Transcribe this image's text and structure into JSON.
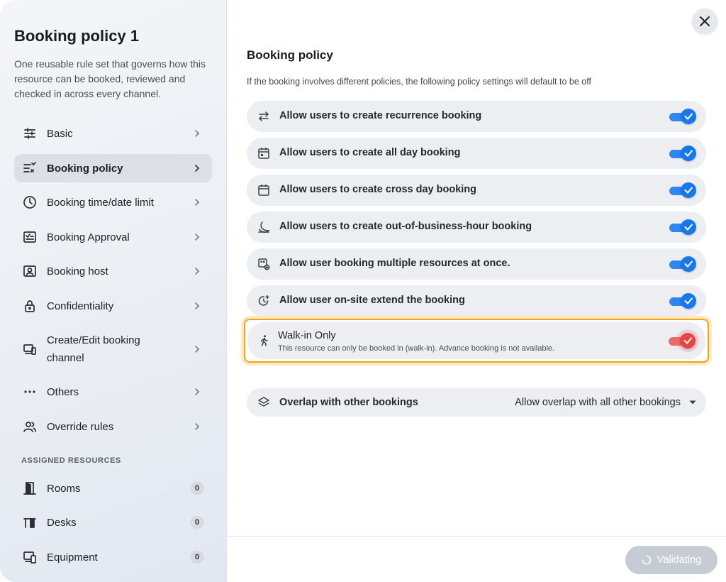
{
  "sidebar": {
    "title": "Booking policy 1",
    "description": "One reusable rule set that governs how this resource can be booked, reviewed and checked in across every channel.",
    "items": [
      {
        "label": "Basic",
        "icon": "sliders-icon"
      },
      {
        "label": "Booking policy",
        "icon": "list-check-icon",
        "active": true
      },
      {
        "label": "Booking time/date limit",
        "icon": "clock-icon"
      },
      {
        "label": "Booking Approval",
        "icon": "approval-icon"
      },
      {
        "label": "Booking host",
        "icon": "host-icon"
      },
      {
        "label": "Confidentiality",
        "icon": "lock-icon"
      },
      {
        "label": "Create/Edit booking channel",
        "icon": "devices-icon"
      },
      {
        "label": "Others",
        "icon": "more-icon"
      },
      {
        "label": "Override rules",
        "icon": "users-icon"
      }
    ],
    "resources_heading": "ASSIGNED RESOURCES",
    "resources": [
      {
        "label": "Rooms",
        "count": "0",
        "icon": "door-icon"
      },
      {
        "label": "Desks",
        "count": "0",
        "icon": "desk-icon"
      },
      {
        "label": "Equipment",
        "count": "0",
        "icon": "equipment-icon"
      }
    ]
  },
  "main": {
    "title": "Booking policy",
    "subtitle": "If the booking involves different policies, the following policy settings will default to be off",
    "settings": [
      {
        "label": "Allow users to create recurrence booking",
        "icon": "repeat-icon",
        "enabled": true
      },
      {
        "label": "Allow users to create all day booking",
        "icon": "calendar-icon",
        "enabled": true
      },
      {
        "label": "Allow users to create cross day booking",
        "icon": "calendar-range-icon",
        "enabled": true
      },
      {
        "label": "Allow users to create out-of-business-hour booking",
        "icon": "moon-icon",
        "enabled": true
      },
      {
        "label": "Allow user booking multiple resources at once.",
        "icon": "multi-resource-icon",
        "enabled": true
      },
      {
        "label": "Allow user on-site extend the booking",
        "icon": "clock-plus-icon",
        "enabled": true
      }
    ],
    "walk_in": {
      "title": "Walk-in Only",
      "description": "This resource can only be booked in (walk-in). Advance booking is not available.",
      "icon": "walking-person-icon",
      "enabled": true,
      "highlight_color": "#f0a41c",
      "toggle_color": "#e94444"
    },
    "overlap": {
      "label": "Overlap with other bookings",
      "value": "Allow overlap with all other bookings",
      "icon": "layers-icon"
    },
    "footer": {
      "validate_label": "Validating"
    }
  },
  "colors": {
    "accent": "#1878ea",
    "warning": "#f0a41c",
    "danger": "#e94444"
  }
}
